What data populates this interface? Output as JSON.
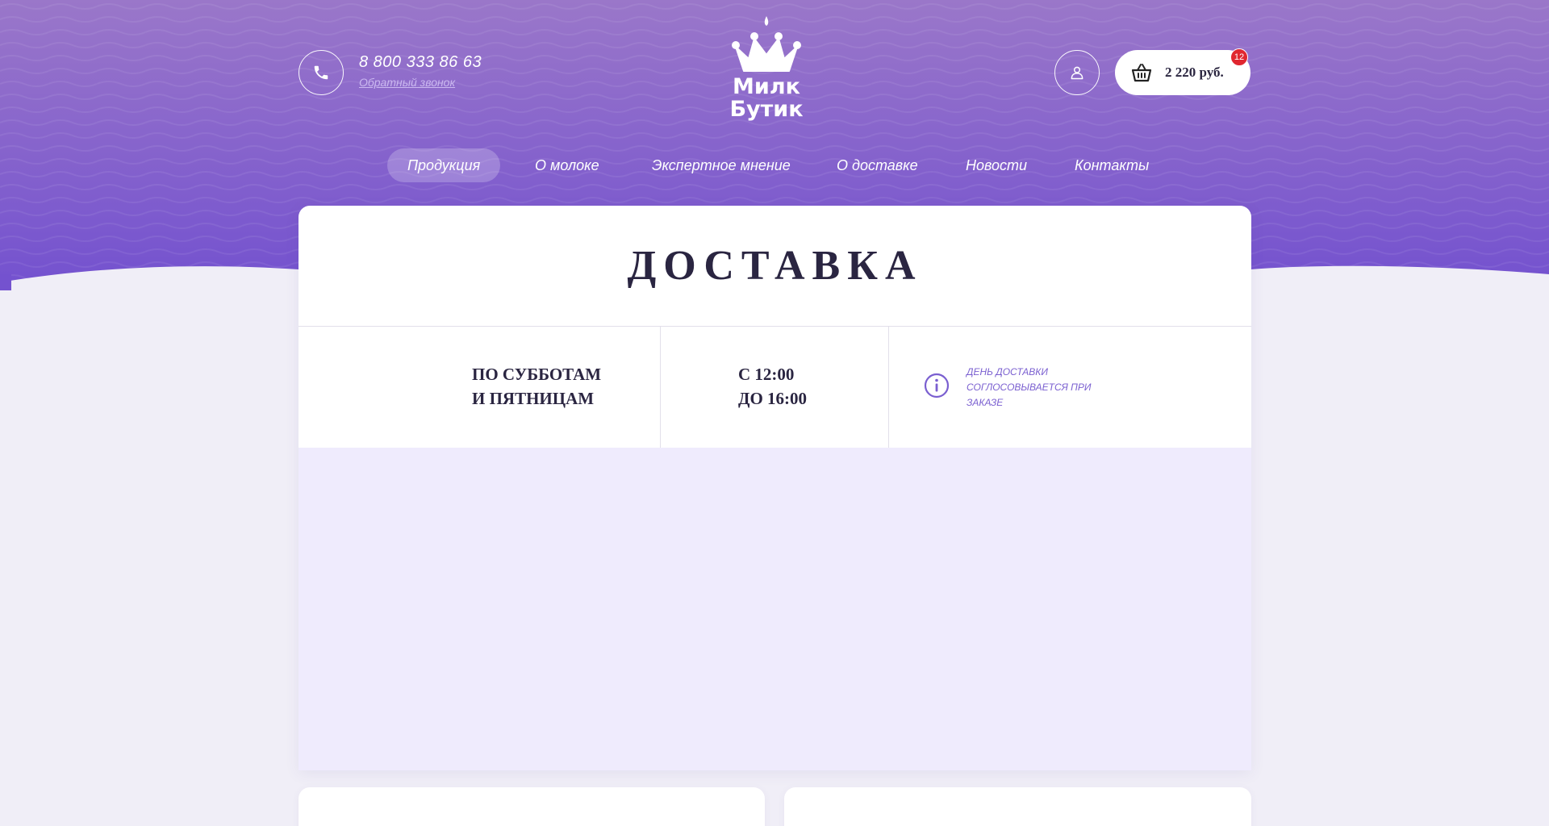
{
  "header": {
    "phone_number": "8 800 333 86 63",
    "callback_label": "Обратный звонок",
    "logo_line1": "Милк",
    "logo_line2": "Бутик",
    "cart_total": "2 220 руб.",
    "cart_count": "12"
  },
  "nav": {
    "items": [
      {
        "label": "Продукция",
        "active": true
      },
      {
        "label": "О молоке",
        "active": false
      },
      {
        "label": "Экспертное мнение",
        "active": false
      },
      {
        "label": "О доставке",
        "active": false
      },
      {
        "label": "Новости",
        "active": false
      },
      {
        "label": "Контакты",
        "active": false
      }
    ]
  },
  "delivery": {
    "title": "ДОСТАВКА",
    "days_line1": "ПО СУББОТАМ",
    "days_line2": "И ПЯТНИЦАМ",
    "hours_line1": "С 12:00",
    "hours_line2": "ДО 16:00",
    "note_line1": "ДЕНЬ ДОСТАВКИ",
    "note_line2": "СОГЛОСОВЫВАЕТСЯ ПРИ",
    "note_line3": "ЗАКАЗЕ"
  },
  "colors": {
    "purple_top": "#9a77c9",
    "purple_bottom": "#7452cf",
    "page_bg": "#f0eef7",
    "map_bg": "#efebfd",
    "badge": "#e0262f",
    "accent": "#7a5fd0"
  }
}
